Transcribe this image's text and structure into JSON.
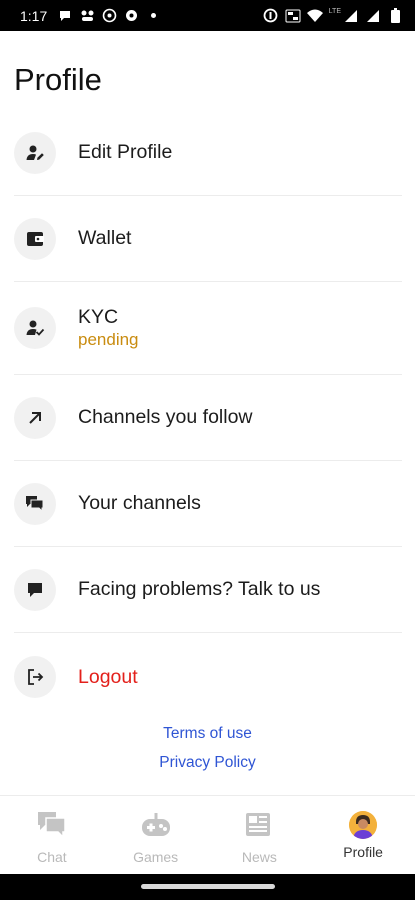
{
  "status_bar": {
    "time": "1:17",
    "left_icons": [
      "chat-bubble-icon",
      "gamepad-notification-icon",
      "whatsapp-icon",
      "record-icon",
      "dot-icon"
    ],
    "right_icons": [
      "data-saver-icon",
      "volte-icon",
      "wifi-icon",
      "signal-icon",
      "signal-icon",
      "battery-icon"
    ],
    "network_label": "LTE"
  },
  "page": {
    "title": "Profile"
  },
  "menu": {
    "items": [
      {
        "label": "Edit Profile",
        "icon": "user-edit-icon"
      },
      {
        "label": "Wallet",
        "icon": "wallet-icon"
      },
      {
        "label": "KYC",
        "sublabel": "pending",
        "icon": "user-check-icon"
      },
      {
        "label": "Channels you follow",
        "icon": "arrow-up-right-icon"
      },
      {
        "label": "Your channels",
        "icon": "chat-bubbles-icon"
      },
      {
        "label": "Facing problems? Talk to us",
        "icon": "chat-icon"
      },
      {
        "label": "Logout",
        "icon": "logout-icon"
      }
    ]
  },
  "colors": {
    "pending": "#c98c10",
    "logout": "#e3201b",
    "link": "#2f55d4"
  },
  "links": {
    "terms": "Terms of use",
    "privacy": "Privacy Policy"
  },
  "bottom_nav": {
    "items": [
      {
        "label": "Chat",
        "icon": "chat-icon",
        "active": false
      },
      {
        "label": "Games",
        "icon": "gamepad-icon",
        "active": false
      },
      {
        "label": "News",
        "icon": "newspaper-icon",
        "active": false
      },
      {
        "label": "Profile",
        "icon": "avatar",
        "active": true
      }
    ]
  }
}
